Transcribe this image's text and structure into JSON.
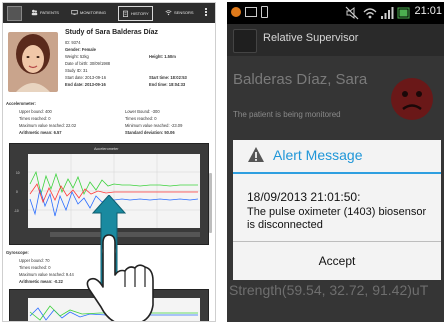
{
  "left": {
    "tabs": [
      {
        "label": "PATIENTS",
        "icon": "people-icon"
      },
      {
        "label": "MONITORING",
        "icon": "monitor-icon"
      },
      {
        "label": "HISTORY",
        "icon": "clipboard-icon"
      },
      {
        "label": "SENSORS",
        "icon": "wifi-icon"
      }
    ],
    "study": {
      "title": "Study of Sara Balderas Díaz",
      "id": "ID: 9374",
      "gender": "Gender: Female",
      "weight": "Weight: 52kg",
      "height": "Height: 1.50m",
      "dob": "Date of birth: 30/09/1988",
      "study_id": "Study ID: 31",
      "start_date": "Start date: 2013-09-16",
      "start_time": "Start time: 18:02:53",
      "end_date": "End date: 2013-09-16",
      "end_time": "End time: 18:04:33"
    },
    "accelerometer": {
      "section_label": "Accelerometer:",
      "upper_bound": "Upper bound: 400",
      "lower_bound": "Lower Bound: -300",
      "times_reached_upper": "Times reached: 0",
      "times_reached_lower": "Times reached: 0",
      "max_value": "Maximum value reached: 22.02",
      "min_value": "Minimum value reached: -23.09",
      "mean": "Arithmetic mean: 6.57",
      "std": "Standard deviation: 50.06",
      "chart_title": "Accelerometer"
    },
    "gyroscope": {
      "section_label": "Gyroscope:",
      "upper_bound": "Upper bound: 70",
      "times_reached": "Times reached: 0",
      "max_value": "Maximum value reached: 9.44",
      "mean": "Arithmetic mean: -0.22"
    }
  },
  "right": {
    "status_time": "21:01",
    "app_title": "Relative Supervisor",
    "patient_name": "Balderas Díaz, Sara",
    "patient_status": "The patient is being monitored",
    "bottom_text": "Strength(59.54, 32.72, 91.42)uT",
    "dialog": {
      "title": "Alert Message",
      "datetime": "18/09/2013 21:01:50:",
      "message": "The pulse oximeter (1403) biosensor is disconnected",
      "accept_label": "Accept"
    }
  },
  "colors": {
    "alert_blue": "#1f96d8",
    "green_series": "#3cd23c",
    "blue_series": "#2a6dff",
    "red_series": "#ff3a3a",
    "cyan_arrow": "#1a8aa0"
  }
}
